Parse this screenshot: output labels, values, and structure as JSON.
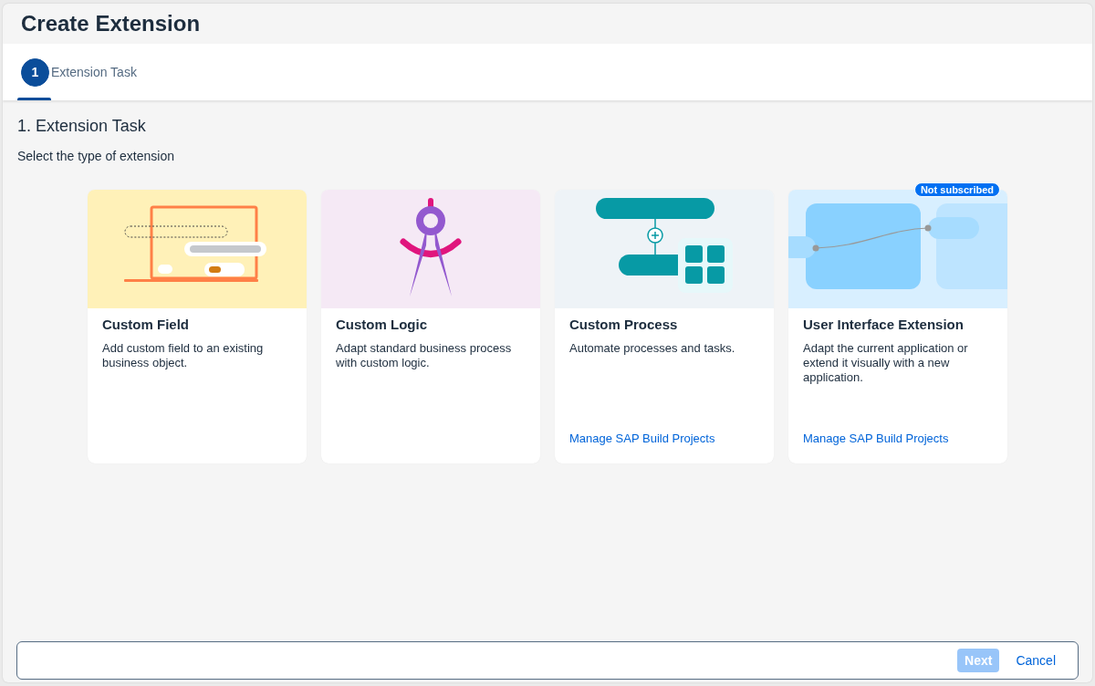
{
  "window": {
    "title": "Create Extension"
  },
  "steps": [
    {
      "number": "1",
      "label": "Extension Task",
      "selected": true
    }
  ],
  "section": {
    "title": "1. Extension Task",
    "subtitle": "Select the type of extension"
  },
  "cards": [
    {
      "kind": "field",
      "title": "Custom Field",
      "description": "Add custom field to an existing business object."
    },
    {
      "kind": "logic",
      "title": "Custom Logic",
      "description": "Adapt standard business process with custom logic."
    },
    {
      "kind": "process",
      "title": "Custom Process",
      "description": "Automate processes and tasks.",
      "link": "Manage SAP Build Projects"
    },
    {
      "kind": "ui",
      "title": "User Interface Extension",
      "description": "Adapt the current application or extend it visually with a new application.",
      "link": "Manage SAP Build Projects",
      "badge": "Not subscribed"
    }
  ],
  "footer": {
    "buttons": [
      {
        "label": "Next",
        "kind": "emphasized",
        "disabled": true
      },
      {
        "label": "Cancel",
        "kind": "transparent",
        "disabled": false
      }
    ]
  }
}
